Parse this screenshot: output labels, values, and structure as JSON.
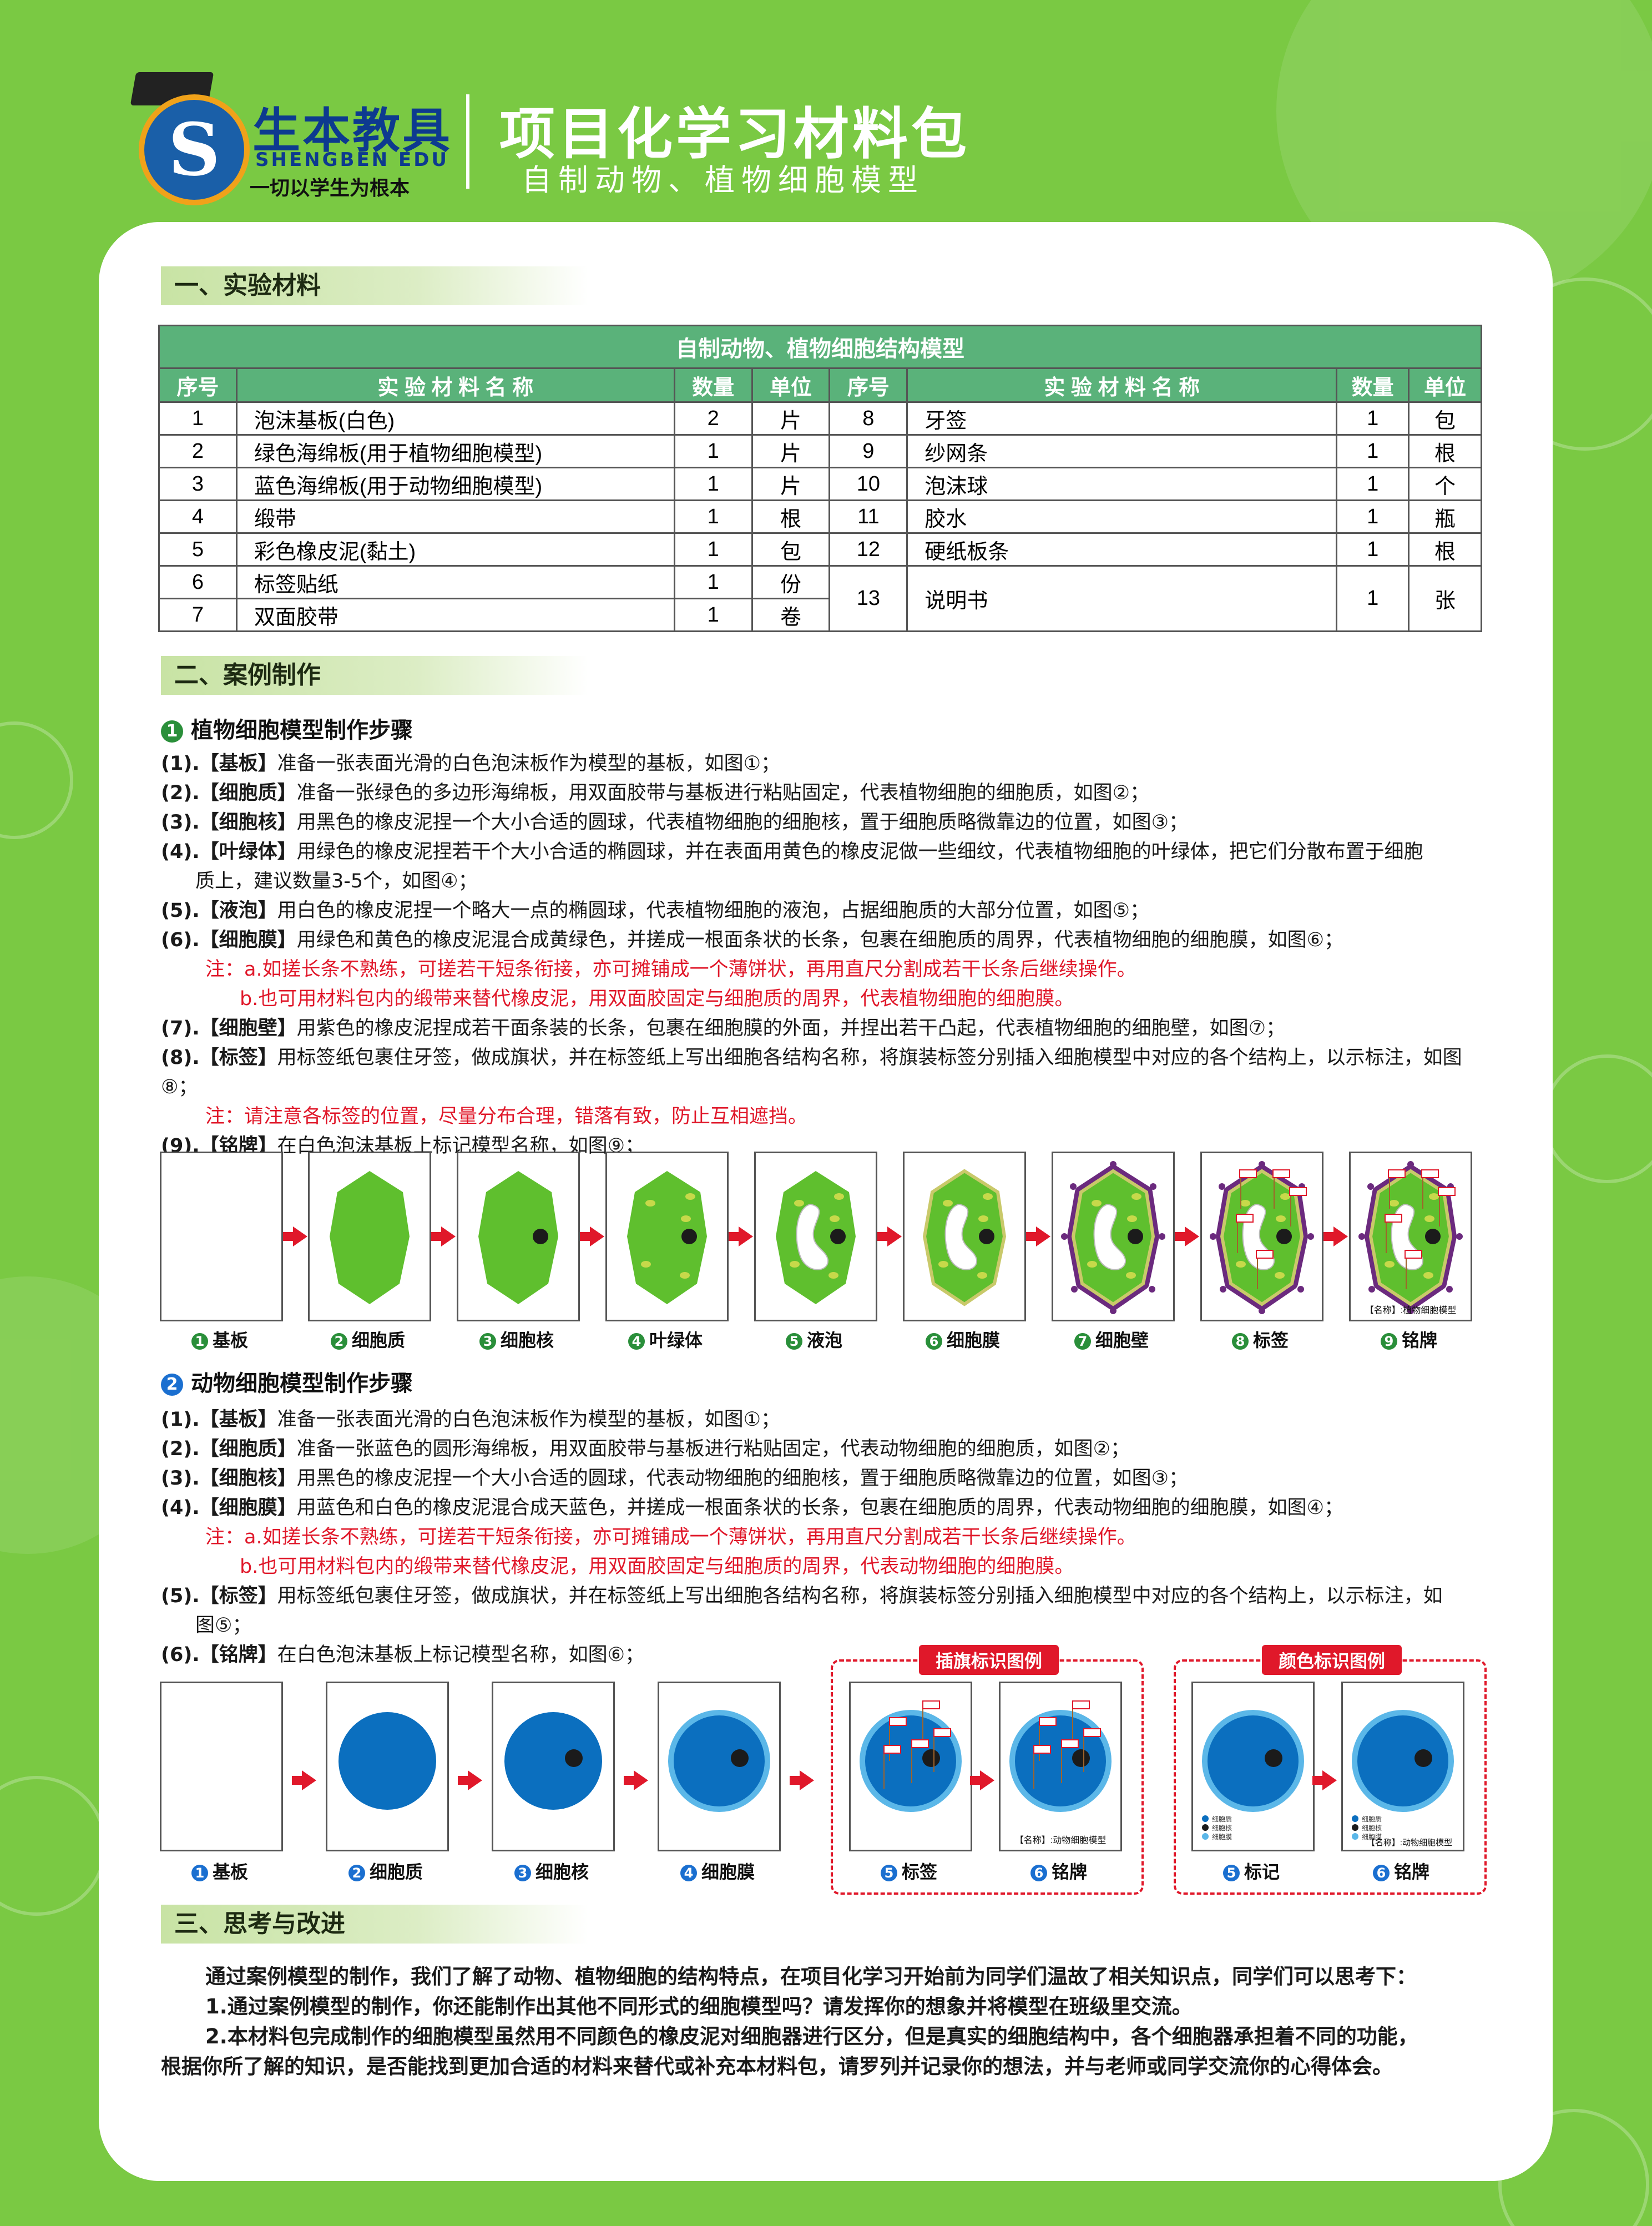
{
  "header": {
    "brand_cn": "生本教具",
    "brand_en": "SHENGBEN EDU",
    "slogan": "一切以学生为根本",
    "title": "项目化学习材料包",
    "subtitle": "自制动物、植物细胞模型"
  },
  "sections": {
    "s1": "一、实验材料",
    "s2": "二、案例制作",
    "s3": "三、思考与改进"
  },
  "table": {
    "caption": "自制动物、植物细胞结构模型",
    "headers": [
      "序号",
      "实 验 材 料 名 称",
      "数量",
      "单位",
      "序号",
      "实 验 材 料 名 称",
      "数量",
      "单位"
    ],
    "left": [
      [
        "1",
        "泡沫基板(白色)",
        "2",
        "片"
      ],
      [
        "2",
        "绿色海绵板(用于植物细胞模型)",
        "1",
        "片"
      ],
      [
        "3",
        "蓝色海绵板(用于动物细胞模型)",
        "1",
        "片"
      ],
      [
        "4",
        "缎带",
        "1",
        "根"
      ],
      [
        "5",
        "彩色橡皮泥(黏土)",
        "1",
        "包"
      ],
      [
        "6",
        "标签贴纸",
        "1",
        "份"
      ],
      [
        "7",
        "双面胶带",
        "1",
        "卷"
      ]
    ],
    "right": [
      [
        "8",
        "牙签",
        "1",
        "包"
      ],
      [
        "9",
        "纱网条",
        "1",
        "根"
      ],
      [
        "10",
        "泡沫球",
        "1",
        "个"
      ],
      [
        "11",
        "胶水",
        "1",
        "瓶"
      ],
      [
        "12",
        "硬纸板条",
        "1",
        "根"
      ],
      [
        "13",
        "说明书",
        "1",
        "张"
      ]
    ]
  },
  "plant": {
    "heading": "植物细胞模型制作步骤",
    "steps": [
      {
        "lead": "(1).【基板】",
        "text": "准备一张表面光滑的白色泡沫板作为模型的基板，如图①；"
      },
      {
        "lead": "(2).【细胞质】",
        "text": "准备一张绿色的多边形海绵板，用双面胶带与基板进行粘贴固定，代表植物细胞的细胞质，如图②；"
      },
      {
        "lead": "(3).【细胞核】",
        "text": "用黑色的橡皮泥捏一个大小合适的圆球，代表植物细胞的细胞核，置于细胞质略微靠边的位置，如图③；"
      },
      {
        "lead": "(4).【叶绿体】",
        "text": "用绿色的橡皮泥捏若干个大小合适的椭圆球，并在表面用黄色的橡皮泥做一些细纹，代表植物细胞的叶绿体，把它们分散布置于细胞"
      },
      {
        "lead": "",
        "text": "质上，建议数量3-5个，如图④；",
        "indent": true
      },
      {
        "lead": "(5).【液泡】",
        "text": "用白色的橡皮泥捏一个略大一点的椭圆球，代表植物细胞的液泡，占据细胞质的大部分位置，如图⑤；"
      },
      {
        "lead": "(6).【细胞膜】",
        "text": "用绿色和黄色的橡皮泥混合成黄绿色，并搓成一根面条状的长条，包裹在细胞质的周界，代表植物细胞的细胞膜，如图⑥；"
      },
      {
        "lead": "",
        "text": "注：a.如搓长条不熟练，可搓若干短条衔接，亦可摊铺成一个薄饼状，再用直尺分割成若干长条后继续操作。",
        "red": true,
        "indent": true
      },
      {
        "lead": "",
        "text": "b.也可用材料包内的缎带来替代橡皮泥，用双面胶固定与细胞质的周界，代表植物细胞的细胞膜。",
        "red": true,
        "indent2": true
      },
      {
        "lead": "(7).【细胞壁】",
        "text": "用紫色的橡皮泥捏成若干面条装的长条，包裹在细胞膜的外面，并捏出若干凸起，代表植物细胞的细胞壁，如图⑦；"
      },
      {
        "lead": "(8).【标签】",
        "text": "用标签纸包裹住牙签，做成旗状，并在标签纸上写出细胞各结构名称，将旗装标签分别插入细胞模型中对应的各个结构上，以示标注，如图⑧；"
      },
      {
        "lead": "",
        "text": "注：请注意各标签的位置，尽量分布合理，错落有致，防止互相遮挡。",
        "red": true,
        "indent": true
      },
      {
        "lead": "(9).【铭牌】",
        "text": "在白色泡沫基板上标记模型名称，如图⑨；"
      }
    ],
    "captions": [
      "基板",
      "细胞质",
      "细胞核",
      "叶绿体",
      "液泡",
      "细胞膜",
      "细胞壁",
      "标签",
      "铭牌"
    ],
    "nameplate": "【名称】:植物细胞模型",
    "tag_text": "标签"
  },
  "animal": {
    "heading": "动物细胞模型制作步骤",
    "steps": [
      {
        "lead": "(1).【基板】",
        "text": "准备一张表面光滑的白色泡沫板作为模型的基板，如图①；"
      },
      {
        "lead": "(2).【细胞质】",
        "text": "准备一张蓝色的圆形海绵板，用双面胶带与基板进行粘贴固定，代表动物细胞的细胞质，如图②；"
      },
      {
        "lead": "(3).【细胞核】",
        "text": "用黑色的橡皮泥捏一个大小合适的圆球，代表动物细胞的细胞核，置于细胞质略微靠边的位置，如图③；"
      },
      {
        "lead": "(4).【细胞膜】",
        "text": "用蓝色和白色的橡皮泥混合成天蓝色，并搓成一根面条状的长条，包裹在细胞质的周界，代表动物细胞的细胞膜，如图④；"
      },
      {
        "lead": "",
        "text": "注：a.如搓长条不熟练，可搓若干短条衔接，亦可摊铺成一个薄饼状，再用直尺分割成若干长条后继续操作。",
        "red": true,
        "indent": true
      },
      {
        "lead": "",
        "text": "b.也可用材料包内的缎带来替代橡皮泥，用双面胶固定与细胞质的周界，代表动物细胞的细胞膜。",
        "red": true,
        "indent2": true
      },
      {
        "lead": "(5).【标签】",
        "text": "用标签纸包裹住牙签，做成旗状，并在标签纸上写出细胞各结构名称，将旗装标签分别插入细胞模型中对应的各个结构上，以示标注，如"
      },
      {
        "lead": "",
        "text": "图⑤；",
        "indent": true
      },
      {
        "lead": "(6).【铭牌】",
        "text": "在白色泡沫基板上标记模型名称，如图⑥；"
      }
    ],
    "captions": [
      "基板",
      "细胞质",
      "细胞核",
      "细胞膜"
    ],
    "flag_legend": {
      "title": "插旗标识图例",
      "captions": [
        "标签",
        "铭牌"
      ]
    },
    "color_legend": {
      "title": "颜色标识图例",
      "captions": [
        "标记",
        "铭牌"
      ],
      "items": [
        "细胞质",
        "细胞核",
        "细胞膜"
      ]
    },
    "nameplate": "【名称】:动物细胞模型"
  },
  "think": {
    "p1": "通过案例模型的制作，我们了解了动物、植物细胞的结构特点，在项目化学习开始前为同学们温故了相关知识点，同学们可以思考下：",
    "p2": "1.通过案例模型的制作，你还能制作出其他不同形式的细胞模型吗？请发挥你的想象并将模型在班级里交流。",
    "p3": "2.本材料包完成制作的细胞模型虽然用不同颜色的橡皮泥对细胞器进行区分，但是真实的细胞结构中，各个细胞器承担着不同的功能，",
    "p4": "根据你所了解的知识，是否能找到更加合适的材料来替代或补充本材料包，请罗列并记录你的想法，并与老师或同学交流你的心得体会。"
  },
  "colors": {
    "background": "#7ac943",
    "table_header": "#5ab27a",
    "plant_green": "#5fbf2e",
    "animal_blue": "#0b6fbf",
    "membrane_blue": "#5bb7e8",
    "wall_purple": "#6b2a7e",
    "accent_red": "#e0182a"
  }
}
